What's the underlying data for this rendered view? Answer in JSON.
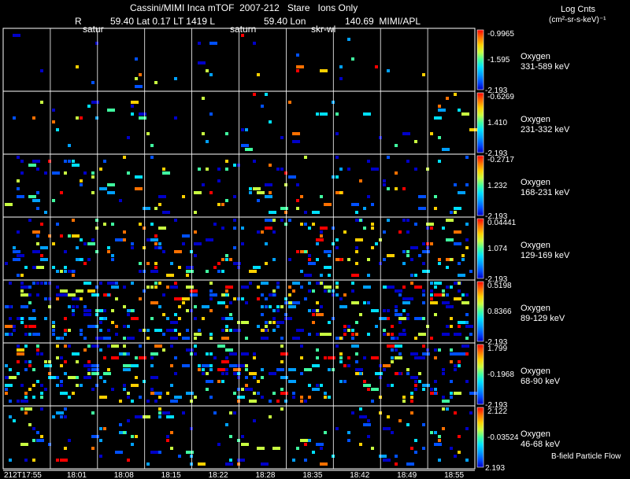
{
  "header": {
    "title": "Cassini/MIMI Inca mTOF  2007-212   Stare   Ions Only",
    "r_label": "R",
    "lat_readout": "59.40 Lat 0.17 LT 1419 L",
    "lon_readout": "59.40 Lon",
    "lon_value": "140.69  MIMI/APL",
    "units_title": "Log Cnts",
    "units": "(cm²-sr-s-keV)⁻¹",
    "target_labels": [
      "satur",
      "saturn",
      "skr-wl"
    ]
  },
  "footer": {
    "flow_label": "B-field Particle Flow"
  },
  "colors": {
    "background": "#000000",
    "grid": "#ffffff",
    "colormap": [
      "#0000c8",
      "#0050ff",
      "#00a0ff",
      "#00e0ff",
      "#40ffa0",
      "#c8ff40",
      "#ffd000",
      "#ff7000",
      "#ff0000"
    ]
  },
  "chart_data": {
    "type": "heatmap",
    "x_ticks": [
      "212T17:55",
      "18:01",
      "18:08",
      "18:15",
      "18:22",
      "18:28",
      "18:35",
      "18:42",
      "18:49",
      "18:55"
    ],
    "panels": [
      {
        "species": "Oxygen",
        "energy": "331-589 keV",
        "cmax": "-0.9965",
        "cmid": "-1.595",
        "cmin": "-2.193",
        "density": 0.018,
        "seed": 11
      },
      {
        "species": "Oxygen",
        "energy": "231-332 keV",
        "cmax": "-0.6269",
        "cmid": "1.410",
        "cmin": "-2.193",
        "density": 0.03,
        "seed": 23
      },
      {
        "species": "Oxygen",
        "energy": "168-231 keV",
        "cmax": "-0.2717",
        "cmid": "1.232",
        "cmin": "-2.193",
        "density": 0.07,
        "seed": 37
      },
      {
        "species": "Oxygen",
        "energy": "129-169 keV",
        "cmax": "0.04441",
        "cmid": "1.074",
        "cmin": "-2.193",
        "density": 0.12,
        "seed": 41
      },
      {
        "species": "Oxygen",
        "energy": "89-129 keV",
        "cmax": "0.5198",
        "cmid": "0.8366",
        "cmin": "-2.193",
        "density": 0.2,
        "seed": 53
      },
      {
        "species": "Oxygen",
        "energy": "68-90 keV",
        "cmax": "1.799",
        "cmid": "-0.1968",
        "cmin": "-2.193",
        "density": 0.15,
        "seed": 67
      },
      {
        "species": "Oxygen",
        "energy": "46-68 keV",
        "cmax": "2.122",
        "cmid": "-0.03524",
        "cmin": "2.193",
        "density": 0.08,
        "seed": 79
      }
    ]
  }
}
